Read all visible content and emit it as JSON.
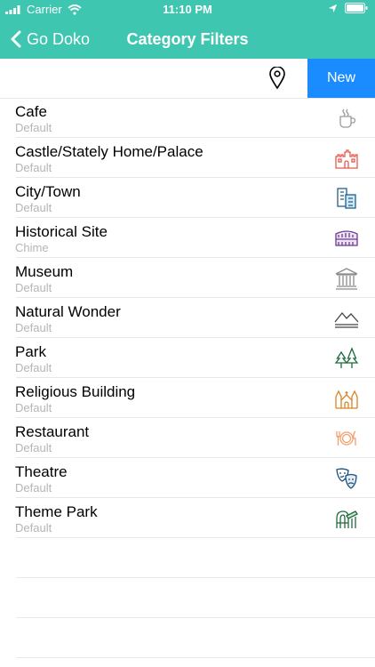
{
  "colors": {
    "accent": "#3fc6b0",
    "new_button": "#1a8cff"
  },
  "status_bar": {
    "carrier": "Carrier",
    "time": "11:10 PM"
  },
  "nav": {
    "back_label": "Go Doko",
    "title": "Category Filters"
  },
  "toolbar": {
    "new_label": "New"
  },
  "categories": [
    {
      "name": "Cafe",
      "sub": "Default",
      "icon": "coffee-cup-icon"
    },
    {
      "name": "Castle/Stately Home/Palace",
      "sub": "Default",
      "icon": "castle-icon"
    },
    {
      "name": "City/Town",
      "sub": "Default",
      "icon": "buildings-icon"
    },
    {
      "name": "Historical Site",
      "sub": "Chime",
      "icon": "colosseum-icon"
    },
    {
      "name": "Museum",
      "sub": "Default",
      "icon": "museum-icon"
    },
    {
      "name": "Natural Wonder",
      "sub": "Default",
      "icon": "mountains-icon"
    },
    {
      "name": "Park",
      "sub": "Default",
      "icon": "trees-icon"
    },
    {
      "name": "Religious Building",
      "sub": "Default",
      "icon": "cathedral-icon"
    },
    {
      "name": "Restaurant",
      "sub": "Default",
      "icon": "plate-cutlery-icon"
    },
    {
      "name": "Theatre",
      "sub": "Default",
      "icon": "theatre-masks-icon"
    },
    {
      "name": "Theme Park",
      "sub": "Default",
      "icon": "rollercoaster-icon"
    }
  ]
}
